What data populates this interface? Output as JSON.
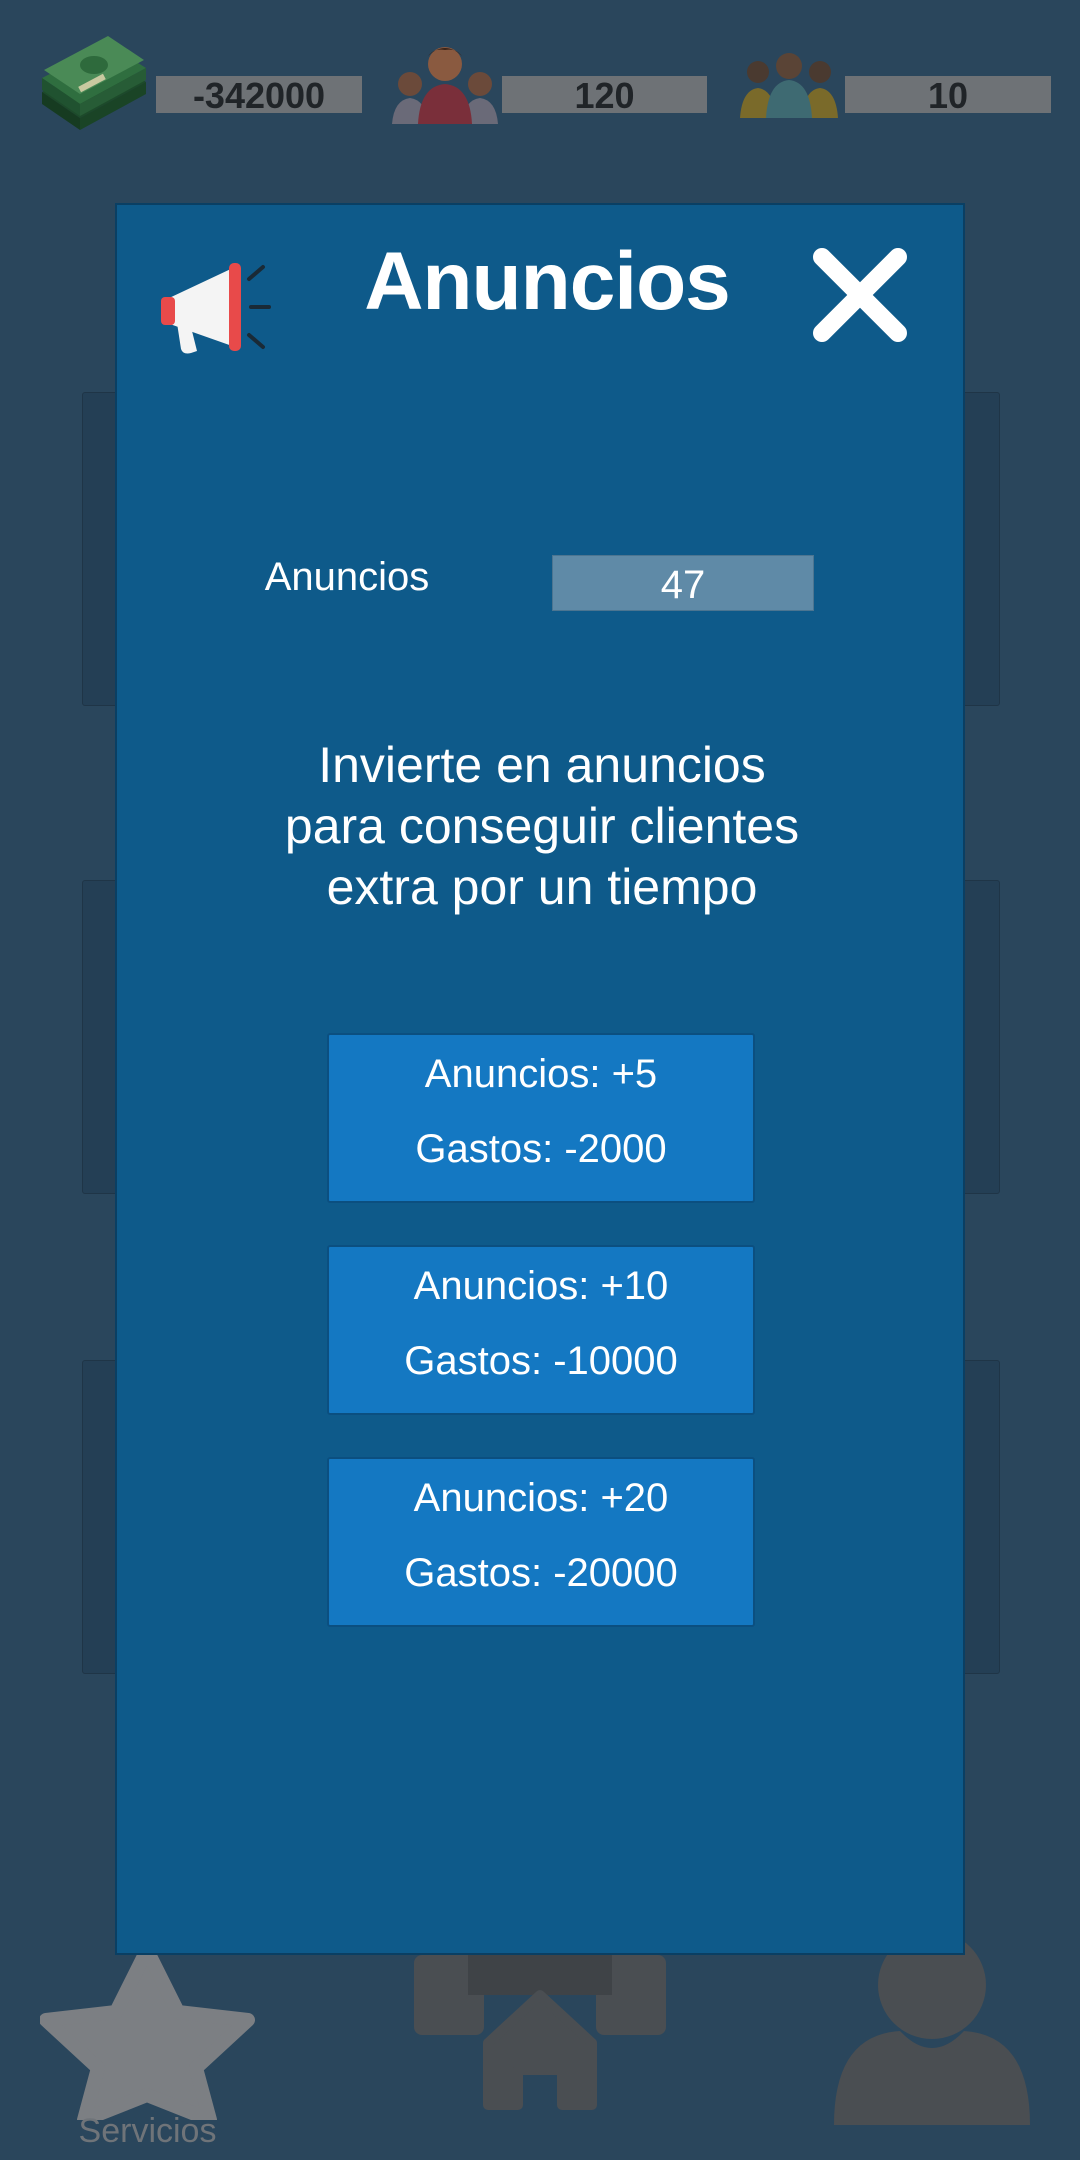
{
  "status_bar": {
    "money": "-342000",
    "customers": "120",
    "employees": "10",
    "money_icon": "cash-stack-icon",
    "customers_icon": "people-group-icon",
    "employees_icon": "staff-group-icon"
  },
  "bottom_nav": {
    "services_label": "Servicios",
    "services_icon": "star-icon",
    "home_icon": "home-icon",
    "profile_icon": "user-icon"
  },
  "modal": {
    "title": "Anuncios",
    "title_icon": "megaphone-icon",
    "close_icon": "close-icon",
    "ads_label": "Anuncios",
    "ads_value": "47",
    "description_lines": [
      "Invierte en anuncios",
      "para conseguir clientes",
      "extra por un tiempo"
    ],
    "offers": [
      {
        "ads": "Anuncios: +5",
        "cost": "Gastos: -2000"
      },
      {
        "ads": "Anuncios: +10",
        "cost": "Gastos: -10000"
      },
      {
        "ads": "Anuncios: +20",
        "cost": "Gastos: -20000"
      }
    ]
  },
  "colors": {
    "modal_bg": "#0e5a8a",
    "offer_button": "#1478c2",
    "page_overlay": "#2a465c",
    "stat_box": "#6e7276"
  }
}
